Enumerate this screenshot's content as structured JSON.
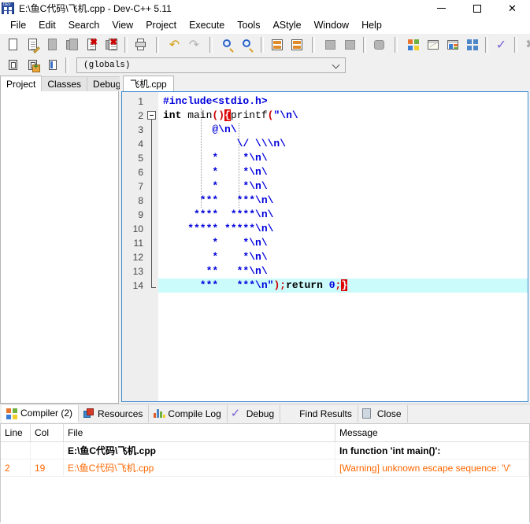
{
  "window": {
    "title": "E:\\鱼C代码\\飞机.cpp - Dev-C++ 5.11",
    "app_icon": "devcpp-icon",
    "minimize_label": "—",
    "maximize_label": "▢",
    "close_label": "✕"
  },
  "menubar": {
    "items": [
      {
        "label": "File"
      },
      {
        "label": "Edit"
      },
      {
        "label": "Search"
      },
      {
        "label": "View"
      },
      {
        "label": "Project"
      },
      {
        "label": "Execute"
      },
      {
        "label": "Tools"
      },
      {
        "label": "AStyle"
      },
      {
        "label": "Window"
      },
      {
        "label": "Help"
      }
    ]
  },
  "toolbar": {
    "buttons": [
      {
        "name": "new-file-icon",
        "enabled": true
      },
      {
        "name": "open-file-icon",
        "enabled": true
      },
      {
        "name": "save-file-icon",
        "enabled": false
      },
      {
        "name": "save-all-icon",
        "enabled": false
      },
      {
        "name": "close-file-icon",
        "enabled": true
      },
      {
        "name": "close-all-icon",
        "enabled": true
      },
      {
        "name": "print-icon",
        "enabled": true
      },
      {
        "name": "undo-icon",
        "enabled": true
      },
      {
        "name": "redo-icon",
        "enabled": false
      },
      {
        "name": "find-icon",
        "enabled": true
      },
      {
        "name": "replace-icon",
        "enabled": true
      },
      {
        "name": "goto-line-icon",
        "enabled": true
      },
      {
        "name": "goto-function-icon",
        "enabled": true
      },
      {
        "name": "compile-current-icon",
        "enabled": true
      },
      {
        "name": "back-nav-icon",
        "enabled": false
      },
      {
        "name": "forward-nav-icon",
        "enabled": false
      },
      {
        "name": "toggle-breakpoint-icon",
        "enabled": false
      },
      {
        "name": "compile-icon",
        "enabled": true
      },
      {
        "name": "run-icon",
        "enabled": true
      },
      {
        "name": "compile-run-icon",
        "enabled": true
      },
      {
        "name": "rebuild-all-icon",
        "enabled": true
      },
      {
        "name": "syntax-check-icon",
        "enabled": true
      },
      {
        "name": "stop-execution-icon",
        "enabled": false
      },
      {
        "name": "profile-icon",
        "enabled": true
      },
      {
        "name": "delete-profile-icon",
        "enabled": true
      }
    ],
    "project_buttons": [
      {
        "name": "new-project-icon"
      },
      {
        "name": "add-to-project-icon"
      },
      {
        "name": "project-options-icon"
      }
    ]
  },
  "scope_combo": {
    "value": "(globals)",
    "chevron": "chevron-down-icon"
  },
  "left_panel": {
    "tabs": [
      {
        "label": "Project",
        "active": true
      },
      {
        "label": "Classes",
        "active": false
      },
      {
        "label": "Debug",
        "active": false
      }
    ]
  },
  "editor": {
    "tabs": [
      {
        "label": "飞机.cpp",
        "active": true
      }
    ],
    "line_numbers": [
      "1",
      "2",
      "3",
      "4",
      "5",
      "6",
      "7",
      "8",
      "9",
      "10",
      "11",
      "12",
      "13",
      "14"
    ],
    "highlighted_line": 14,
    "fold_marker_line": 2,
    "lines": [
      {
        "n": 1,
        "tokens": [
          {
            "t": "#include<stdio.h>",
            "c": "str"
          }
        ]
      },
      {
        "n": 2,
        "tokens": [
          {
            "t": "int",
            "c": "kw"
          },
          {
            "t": " main",
            "c": "plain"
          },
          {
            "t": "()",
            "c": "punc"
          },
          {
            "t": "{",
            "c": "brace-hl"
          },
          {
            "t": "printf",
            "c": "plain"
          },
          {
            "t": "(",
            "c": "punc"
          },
          {
            "t": "\"\\n\\",
            "c": "str"
          }
        ]
      },
      {
        "n": 3,
        "tokens": [
          {
            "t": "        @\\n\\",
            "c": "str"
          }
        ]
      },
      {
        "n": 4,
        "tokens": [
          {
            "t": "            \\/ \\\\\\n\\",
            "c": "str"
          }
        ]
      },
      {
        "n": 5,
        "tokens": [
          {
            "t": "        *    *\\n\\",
            "c": "str"
          }
        ]
      },
      {
        "n": 6,
        "tokens": [
          {
            "t": "        *    *\\n\\",
            "c": "str"
          }
        ]
      },
      {
        "n": 7,
        "tokens": [
          {
            "t": "        *    *\\n\\",
            "c": "str"
          }
        ]
      },
      {
        "n": 8,
        "tokens": [
          {
            "t": "      ***   ***\\n\\",
            "c": "str"
          }
        ]
      },
      {
        "n": 9,
        "tokens": [
          {
            "t": "     ****  ****\\n\\",
            "c": "str"
          }
        ]
      },
      {
        "n": 10,
        "tokens": [
          {
            "t": "    ***** *****\\n\\",
            "c": "str"
          }
        ]
      },
      {
        "n": 11,
        "tokens": [
          {
            "t": "        *    *\\n\\",
            "c": "str"
          }
        ]
      },
      {
        "n": 12,
        "tokens": [
          {
            "t": "        *    *\\n\\",
            "c": "str"
          }
        ]
      },
      {
        "n": 13,
        "tokens": [
          {
            "t": "       **   **\\n\\",
            "c": "str"
          }
        ]
      },
      {
        "n": 14,
        "tokens": [
          {
            "t": "      ***   ***\\n",
            "c": "str"
          },
          {
            "t": "\"",
            "c": "str"
          },
          {
            "t": ")",
            "c": "punc"
          },
          {
            "t": ";",
            "c": "punc"
          },
          {
            "t": "return",
            "c": "kw"
          },
          {
            "t": " ",
            "c": "plain"
          },
          {
            "t": "0",
            "c": "num"
          },
          {
            "t": ";",
            "c": "punc"
          },
          {
            "t": "}",
            "c": "brace-hl"
          }
        ]
      }
    ]
  },
  "bottom_panel": {
    "tabs": [
      {
        "label": "Compiler (2)",
        "icon": "compiler-icon",
        "active": true
      },
      {
        "label": "Resources",
        "icon": "resources-icon",
        "active": false
      },
      {
        "label": "Compile Log",
        "icon": "compile-log-icon",
        "active": false
      },
      {
        "label": "Debug",
        "icon": "debug-check-icon",
        "active": false
      },
      {
        "label": "Find Results",
        "icon": "find-results-icon",
        "active": false
      },
      {
        "label": "Close",
        "icon": "close-red-icon",
        "active": false
      }
    ],
    "grid": {
      "columns": [
        "Line",
        "Col",
        "File",
        "Message"
      ],
      "rows": [
        {
          "type": "file",
          "line": "",
          "col": "",
          "file": "E:\\鱼C代码\\飞机.cpp",
          "message": "In function 'int main()':"
        },
        {
          "type": "warning",
          "line": "2",
          "col": "19",
          "file": "E:\\鱼C代码\\飞机.cpp",
          "message": "[Warning] unknown escape sequence: '\\/'"
        }
      ]
    }
  },
  "colors": {
    "accent_blue": "#3a8ad0",
    "string_blue": "#0000dd",
    "punct_red": "#cc0000",
    "brace_highlight_bg": "#dd0000",
    "warning_orange": "#ff6600",
    "line_highlight": "#ccfbfb",
    "toolbar_bg": "#f0f0f0"
  }
}
